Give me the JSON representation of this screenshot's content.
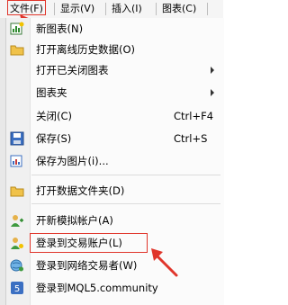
{
  "menubar": {
    "items": [
      {
        "label": "文件(F)"
      },
      {
        "label": "显示(V)"
      },
      {
        "label": "插入(I)"
      },
      {
        "label": "图表(C)"
      }
    ]
  },
  "file_menu": {
    "items": [
      {
        "label": "新图表(N)",
        "shortcut": "",
        "icon": "new-chart-icon"
      },
      {
        "label": "打开离线历史数据(O)",
        "shortcut": "",
        "icon": "folder-icon"
      },
      {
        "label": "打开已关闭图表",
        "shortcut": "",
        "icon": ""
      },
      {
        "label": "图表夹",
        "shortcut": "",
        "icon": ""
      },
      {
        "label": "关闭(C)",
        "shortcut": "Ctrl+F4",
        "icon": ""
      },
      {
        "label": "保存(S)",
        "shortcut": "Ctrl+S",
        "icon": "floppy-disk-icon"
      },
      {
        "label": "保存为图片(i)...",
        "shortcut": "",
        "icon": "save-picture-icon"
      },
      {
        "label": "打开数据文件夹(D)",
        "shortcut": "",
        "icon": "folder-icon"
      },
      {
        "label": "开新模拟帐户(A)",
        "shortcut": "",
        "icon": "user-add-icon"
      },
      {
        "label": "登录到交易账户(L)",
        "shortcut": "",
        "icon": "user-login-icon"
      },
      {
        "label": "登录到网络交易者(W)",
        "shortcut": "",
        "icon": "globe-user-icon"
      },
      {
        "label": "登录到MQL5.community",
        "shortcut": "",
        "icon": "mql5-icon"
      }
    ]
  },
  "colors": {
    "annotation_red": "#e0352b",
    "menubar_bg": "#f5f5f5",
    "menu_bg": "#fbfbfb"
  }
}
